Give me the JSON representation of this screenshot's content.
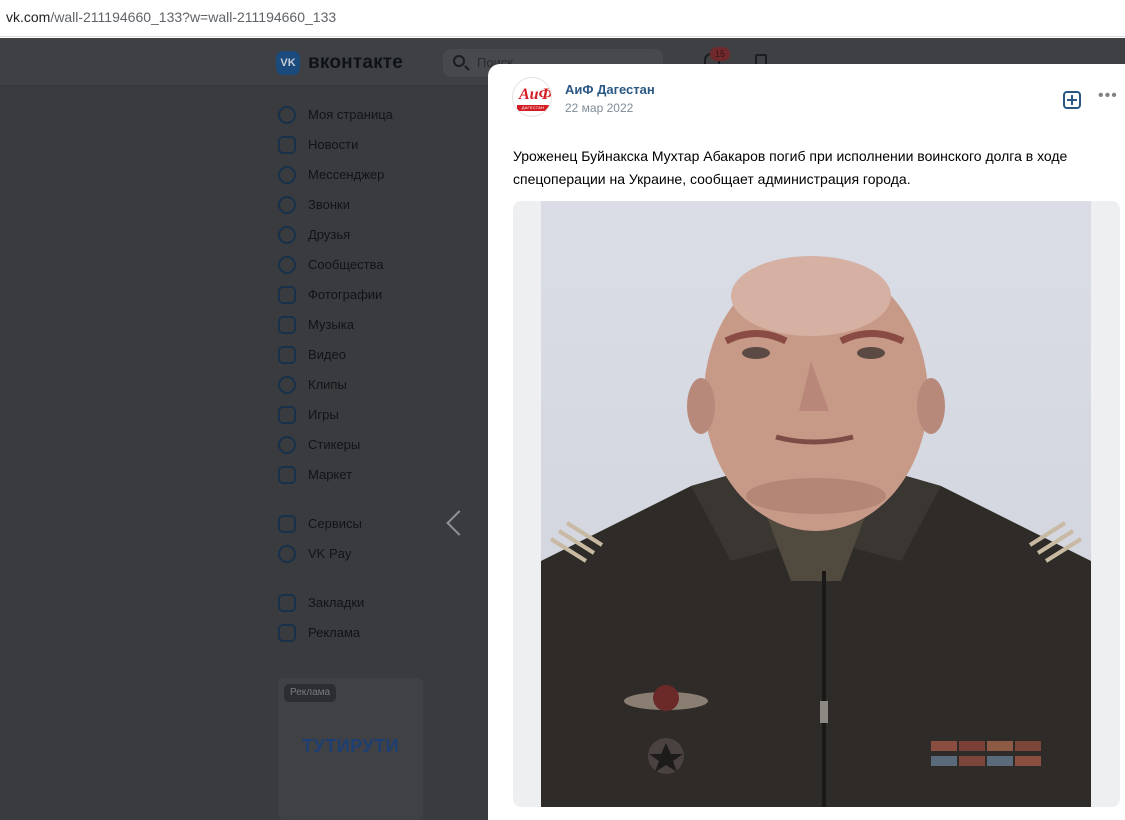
{
  "browser": {
    "url_host": "vk.com",
    "url_path": "/wall-211194660_133?w=wall-211194660_133"
  },
  "vk": {
    "logo_text": "VK",
    "brand": "вконтакте",
    "search_placeholder": "Поиск",
    "notifications_count": "15",
    "sidebar": [
      {
        "label": "Моя страница",
        "icon": "user-icon"
      },
      {
        "label": "Новости",
        "icon": "news-icon"
      },
      {
        "label": "Мессенджер",
        "icon": "chat-icon"
      },
      {
        "label": "Звонки",
        "icon": "phone-icon"
      },
      {
        "label": "Друзья",
        "icon": "friends-icon"
      },
      {
        "label": "Сообщества",
        "icon": "communities-icon"
      },
      {
        "label": "Фотографии",
        "icon": "photo-icon"
      },
      {
        "label": "Музыка",
        "icon": "music-icon"
      },
      {
        "label": "Видео",
        "icon": "video-icon"
      },
      {
        "label": "Клипы",
        "icon": "clips-icon"
      },
      {
        "label": "Игры",
        "icon": "games-icon"
      },
      {
        "label": "Стикеры",
        "icon": "stickers-icon"
      },
      {
        "label": "Маркет",
        "icon": "market-icon"
      },
      {
        "label": "Сервисы",
        "icon": "services-icon"
      },
      {
        "label": "VK Pay",
        "icon": "vkpay-icon"
      },
      {
        "label": "Закладки",
        "icon": "bookmark-icon"
      },
      {
        "label": "Реклама",
        "icon": "megaphone-icon"
      }
    ],
    "ad": {
      "tag": "Реклама",
      "brand": "ТУТИРУТИ"
    }
  },
  "post": {
    "author": "АиФ Дагестан",
    "date": "22 мар 2022",
    "avatar_mark": "АиФ",
    "avatar_caption": "ДАГЕСТАН",
    "text": "Уроженец Буйнакска Мухтар Абакаров погиб при исполнении воинского долга в ходе спецоперации на Украине, сообщает администрация города.",
    "more_label": "•••"
  },
  "colors": {
    "link": "#2a5885",
    "overlay_bg": "#393b3f",
    "brand_red": "#d41c24"
  }
}
